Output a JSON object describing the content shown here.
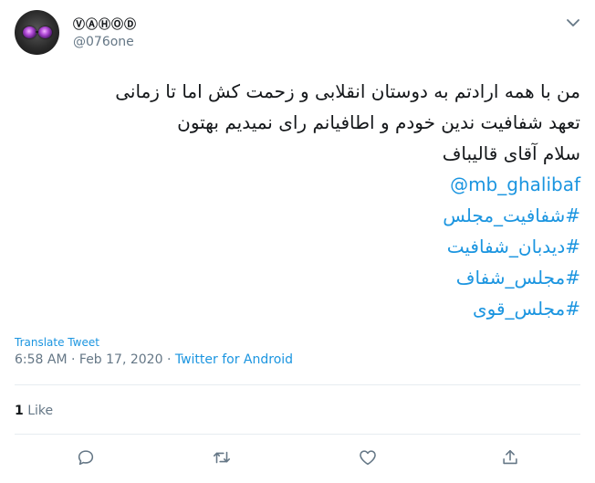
{
  "author": {
    "display_name": "ⓋⒶⒽⓄⒹ",
    "username": "@076one"
  },
  "tweet": {
    "lines": [
      "من با همه ارادتم به دوستان انقلابی و زحمت کش اما تا زمانی",
      "تعهد شفافیت ندین خودم و اطافیانم رای نمیدیم بهتون",
      "سلام آقای قالیباف"
    ],
    "mention": "@mb_ghalibaf",
    "hashtags": [
      "#شفافیت_مجلس",
      "#دیدبان_شفافیت",
      "#مجلس_شفاف",
      "#مجلس_قوی"
    ]
  },
  "translate_label": "Translate Tweet",
  "meta": {
    "time": "6:58 AM",
    "sep1": " · ",
    "date": "Feb 17, 2020",
    "sep2": " · ",
    "source": "Twitter for Android"
  },
  "stats": {
    "like_count": "1",
    "like_label": " Like"
  },
  "icons": {
    "more": "chevron-down-icon",
    "reply": "reply-icon",
    "retweet": "retweet-icon",
    "like": "heart-icon",
    "share": "share-icon"
  },
  "colors": {
    "link": "#1b95e0",
    "muted": "#657786",
    "text": "#14171a"
  }
}
